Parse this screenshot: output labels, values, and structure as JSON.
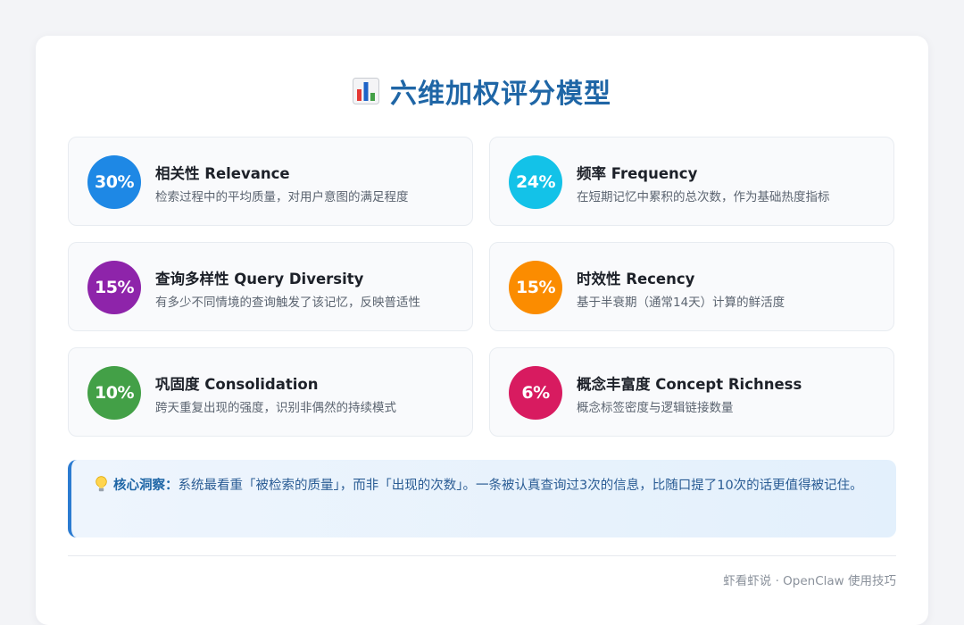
{
  "title": "六维加权评分模型",
  "title_icon": "bar-chart-icon",
  "metrics": [
    {
      "percent": "30%",
      "name": "相关性 Relevance",
      "desc": "检索过程中的平均质量，对用户意图的满足程度",
      "color": "#1e88e5"
    },
    {
      "percent": "24%",
      "name": "频率 Frequency",
      "desc": "在短期记忆中累积的总次数，作为基础热度指标",
      "color": "#13c2e8"
    },
    {
      "percent": "15%",
      "name": "查询多样性 Query Diversity",
      "desc": "有多少不同情境的查询触发了该记忆，反映普适性",
      "color": "#8e24aa"
    },
    {
      "percent": "15%",
      "name": "时效性 Recency",
      "desc": "基于半衰期（通常14天）计算的鲜活度",
      "color": "#fb8c00"
    },
    {
      "percent": "10%",
      "name": "巩固度 Consolidation",
      "desc": "跨天重复出现的强度，识别非偶然的持续模式",
      "color": "#43a047"
    },
    {
      "percent": "6%",
      "name": "概念丰富度 Concept Richness",
      "desc": "概念标签密度与逻辑链接数量",
      "color": "#d81b60"
    }
  ],
  "insight": {
    "icon": "lightbulb-icon",
    "label": "核心洞察：",
    "text": "系统最看重「被检索的质量」，而非「出现的次数」。一条被认真查询过3次的信息，比随口提了10次的话更值得被记住。"
  },
  "footer": "虾看虾说 · OpenClaw 使用技巧"
}
